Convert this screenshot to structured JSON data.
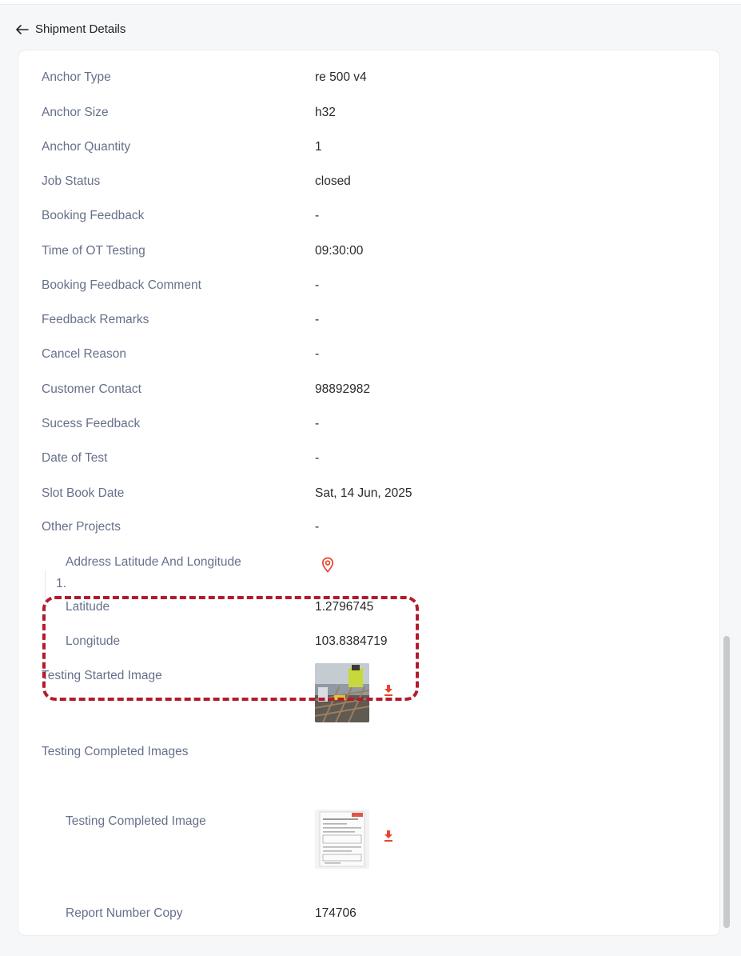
{
  "header": {
    "title": "Shipment Details",
    "back_icon": "arrow-left-icon"
  },
  "fields": [
    {
      "label": "Anchor Type",
      "value": "re 500 v4"
    },
    {
      "label": "Anchor Size",
      "value": "h32"
    },
    {
      "label": "Anchor Quantity",
      "value": "1"
    },
    {
      "label": "Job Status",
      "value": "closed"
    },
    {
      "label": "Booking Feedback",
      "value": "-"
    },
    {
      "label": "Time of OT Testing",
      "value": "09:30:00"
    },
    {
      "label": "Booking Feedback Comment",
      "value": "-"
    },
    {
      "label": "Feedback Remarks",
      "value": "-"
    },
    {
      "label": "Cancel Reason",
      "value": "-"
    },
    {
      "label": "Customer Contact",
      "value": "98892982"
    },
    {
      "label": "Sucess Feedback",
      "value": "-"
    },
    {
      "label": "Date of Test",
      "value": "-"
    },
    {
      "label": "Slot Book Date",
      "value": "Sat, 14 Jun, 2025"
    },
    {
      "label": "Other Projects",
      "value": "-"
    }
  ],
  "location": {
    "address_label": "Address Latitude And Longitude",
    "pin_icon": "map-pin-icon",
    "latitude_label": "Latitude",
    "latitude": "1.2796745",
    "longitude_label": "Longitude",
    "longitude": "103.8384719"
  },
  "testing_started": {
    "label": "Testing Started Image",
    "download_icon": "download-icon"
  },
  "testing_completed": {
    "section_label": "Testing Completed Images",
    "items": [
      {
        "number": "1.",
        "image_label": "Testing Completed Image",
        "report_label": "Report Number Copy",
        "report_value": "174706"
      }
    ]
  },
  "colors": {
    "accent": "#e8452c",
    "highlight": "#b31b2c",
    "label": "#66708a"
  }
}
